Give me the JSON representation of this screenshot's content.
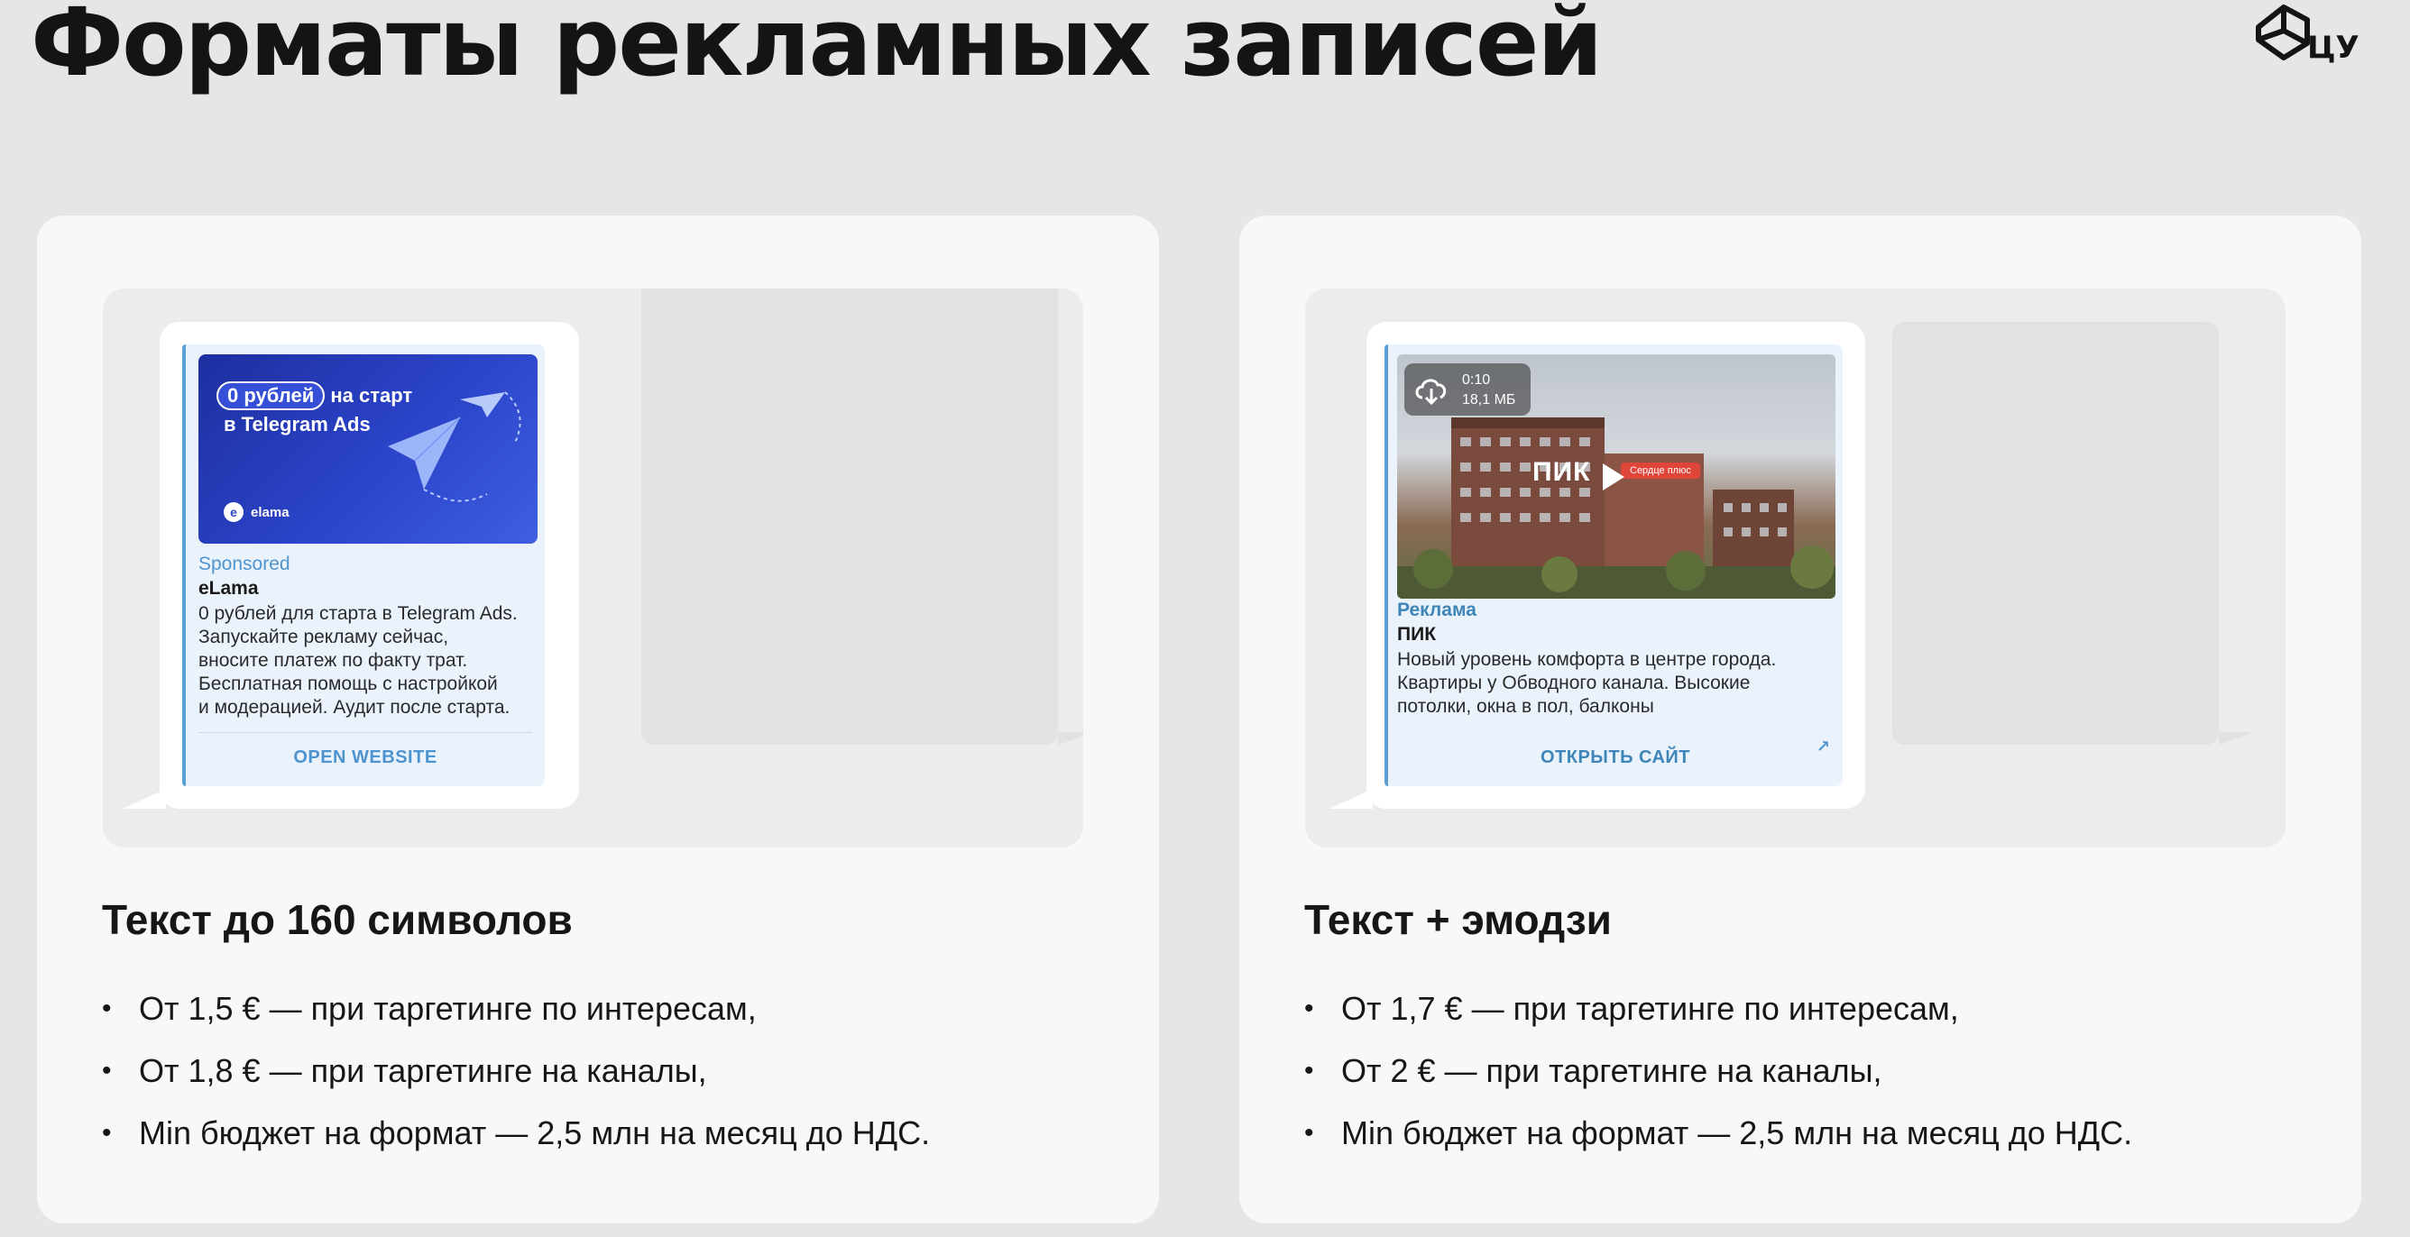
{
  "title": "Форматы рекламных записей",
  "logo": {
    "text": "ЦУ",
    "icon": "cube-logo-icon"
  },
  "cards": [
    {
      "preview": {
        "banner": {
          "pill": "0 рублей",
          "line1_rest": "на старт",
          "line2": "в Telegram Ads",
          "brand": "elama"
        },
        "label": "Sponsored",
        "name": "eLama",
        "text": [
          "0 рублей для старта в Telegram Ads.",
          "Запускайте рекламу сейчас,",
          "вносите платеж по факту трат.",
          "Бесплатная помощь с настройкой",
          "и модерацией. Аудит после старта."
        ],
        "button": "OPEN WEBSITE"
      },
      "heading": "Текст до 160 символов",
      "bullets": [
        "От 1,5 € — при таргетинге по интересам,",
        "От 1,8 € — при таргетинге на каналы,",
        "Min бюджет на формат — 2,5 млн на месяц до НДС."
      ]
    },
    {
      "preview": {
        "media": {
          "duration": "0:10",
          "size": "18,1 МБ",
          "brand": "ПИК",
          "tag": "Сердце плюс"
        },
        "label": "Реклама",
        "name": "ПИК",
        "text": [
          "Новый уровень комфорта в центре города.",
          "Квартиры у Обводного канала. Высокие",
          "потолки, окна в пол, балконы"
        ],
        "button": "ОТКРЫТЬ САЙТ"
      },
      "heading": "Текст + эмодзи",
      "bullets": [
        "От 1,7 € — при таргетинге по интересам,",
        "От 2 € — при таргетинге на каналы,",
        "Min бюджет на формат — 2,5 млн на месяц до НДС."
      ]
    }
  ],
  "colors": {
    "background": "#e6e6e6",
    "card": "#f8f8f8",
    "accent": "#4e94cf"
  }
}
